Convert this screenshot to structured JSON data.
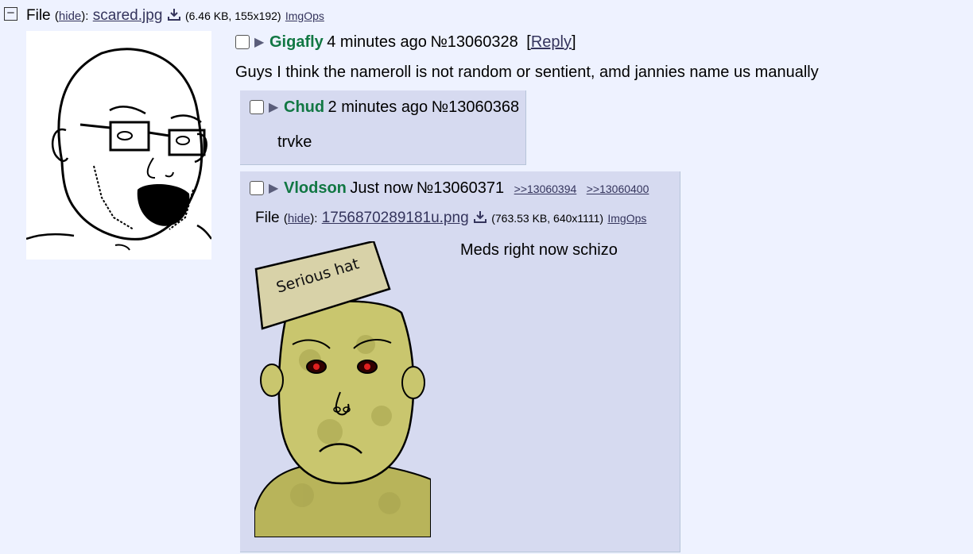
{
  "op": {
    "file_prefix": "File",
    "hide_paren_open": "(",
    "hide_label": "hide",
    "hide_paren_close": "):",
    "filename": "scared.jpg",
    "fileinfo": "(6.46 KB, 155x192)",
    "imgops": "ImgOps",
    "name": "Gigafly",
    "time": "4 minutes ago",
    "postno": "№13060328",
    "reply_open": "[",
    "reply_label": "Reply",
    "reply_close": "]",
    "message": "Guys I think the nameroll is not random or sentient, amd jannies name us manually"
  },
  "replies": [
    {
      "name": "Chud",
      "time": "2 minutes ago",
      "postno": "№13060368",
      "message": "trvke"
    },
    {
      "name": "Vlodson",
      "time": "Just now",
      "postno": "№13060371",
      "backlinks": [
        ">>13060394",
        ">>13060400"
      ],
      "file_prefix": "File",
      "hide_paren_open": "(",
      "hide_label": "hide",
      "hide_paren_close": "):",
      "filename": "1756870289181u.png",
      "fileinfo": "(763.53 KB, 640x1111)",
      "imgops": "ImgOps",
      "message": "Meds right now schizo",
      "image_caption": "Serious hat"
    }
  ],
  "colors": {
    "background": "#eef2ff",
    "reply_bg": "#d6daf0",
    "name": "#117743",
    "link": "#34345c"
  }
}
